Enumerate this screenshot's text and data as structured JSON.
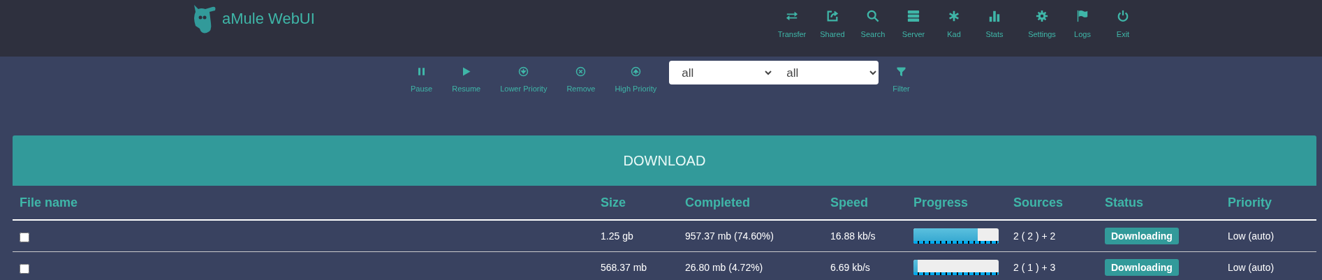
{
  "app": {
    "title": "aMule WebUI"
  },
  "nav": [
    {
      "kind": "transfer",
      "label": "Transfer"
    },
    {
      "kind": "shared",
      "label": "Shared"
    },
    {
      "kind": "search",
      "label": "Search"
    },
    {
      "kind": "server",
      "label": "Server"
    },
    {
      "kind": "kad",
      "label": "Kad"
    },
    {
      "kind": "stats",
      "label": "Stats"
    },
    {
      "kind": "settings",
      "label": "Settings"
    },
    {
      "kind": "logs",
      "label": "Logs"
    },
    {
      "kind": "exit",
      "label": "Exit"
    }
  ],
  "toolbar": [
    {
      "kind": "pause",
      "label": "Pause"
    },
    {
      "kind": "resume",
      "label": "Resume"
    },
    {
      "kind": "lower",
      "label": "Lower Priority"
    },
    {
      "kind": "remove",
      "label": "Remove"
    },
    {
      "kind": "high",
      "label": "High Priority"
    }
  ],
  "filters": [
    {
      "value": "all"
    },
    {
      "value": "all"
    }
  ],
  "filter_button": {
    "label": "Filter"
  },
  "panel": {
    "title": "DOWNLOAD"
  },
  "table": {
    "columns": [
      "File name",
      "Size",
      "Completed",
      "Speed",
      "Progress",
      "Sources",
      "Status",
      "Priority"
    ],
    "rows": [
      {
        "checked": false,
        "size": "1.25 gb",
        "completed": "957.37 mb (74.60%)",
        "speed": "16.88 kb/s",
        "level": 0.75,
        "sources": "2 ( 2 ) + 2",
        "status": "Downloading",
        "priority": "Low (auto)"
      },
      {
        "checked": false,
        "size": "568.37 mb",
        "completed": "26.80 mb (4.72%)",
        "speed": "6.69 kb/s",
        "level": 0.05,
        "sources": "2 ( 1 ) + 3",
        "status": "Downloading",
        "priority": "Low (auto)"
      }
    ]
  }
}
